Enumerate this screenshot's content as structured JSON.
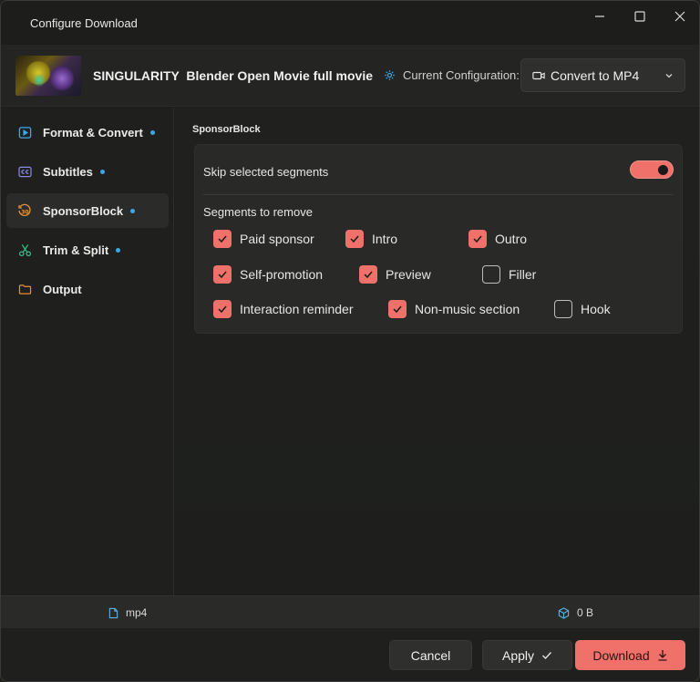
{
  "window": {
    "title": "Configure Download"
  },
  "header": {
    "video_title": "SINGULARITY  Blender Open Movie full movie",
    "config_label": "Current Configuration:",
    "config_value": "Convert to MP4"
  },
  "sidebar": {
    "items": [
      {
        "label": "Format & Convert",
        "icon": "play-box-icon",
        "has_dot": true
      },
      {
        "label": "Subtitles",
        "icon": "closed-caption-icon",
        "has_dot": true
      },
      {
        "label": "SponsorBlock",
        "icon": "skip-30-icon",
        "has_dot": true,
        "active": true
      },
      {
        "label": "Trim & Split",
        "icon": "scissors-icon",
        "has_dot": true
      },
      {
        "label": "Output",
        "icon": "folder-icon",
        "has_dot": false
      }
    ]
  },
  "content": {
    "section_title": "SponsorBlock",
    "skip_label": "Skip selected segments",
    "skip_enabled": true,
    "segments_title": "Segments to remove",
    "segments": [
      {
        "label": "Paid sponsor",
        "checked": true
      },
      {
        "label": "Intro",
        "checked": true
      },
      {
        "label": "Outro",
        "checked": true
      },
      {
        "label": "Self-promotion",
        "checked": true
      },
      {
        "label": "Preview",
        "checked": true
      },
      {
        "label": "Filler",
        "checked": false
      },
      {
        "label": "Interaction reminder",
        "checked": true
      },
      {
        "label": "Non-music section",
        "checked": true
      },
      {
        "label": "Hook",
        "checked": false
      }
    ]
  },
  "status": {
    "format": "mp4",
    "size": "0 B"
  },
  "footer": {
    "cancel_label": "Cancel",
    "apply_label": "Apply",
    "download_label": "Download"
  },
  "colors": {
    "accent": "#f0706a",
    "dot": "#3aa8e8"
  }
}
